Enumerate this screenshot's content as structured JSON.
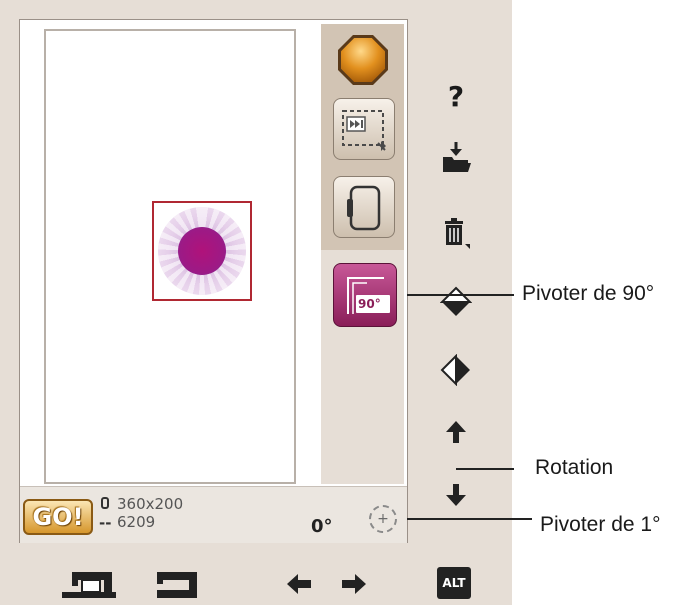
{
  "design": {
    "size": "360x200",
    "stitch_count": "6209",
    "stitch_prefix": "--",
    "rotation_angle": "0°"
  },
  "buttons": {
    "go_label": "GO!",
    "rotate90_label": "90°",
    "alt_label": "ALT",
    "dial_symbol": "+"
  },
  "side_icons": {
    "help": "?"
  },
  "callouts": {
    "rotate90": "Pivoter de 90°",
    "rotation": "Rotation",
    "rotate1": "Pivoter de 1°"
  },
  "colors": {
    "device_bg": "#e6ded6",
    "rail_top": "#d2c4b4",
    "design_frame": "#b02832",
    "rotate_button": "#a8326e",
    "go_button": "#d6962c"
  }
}
